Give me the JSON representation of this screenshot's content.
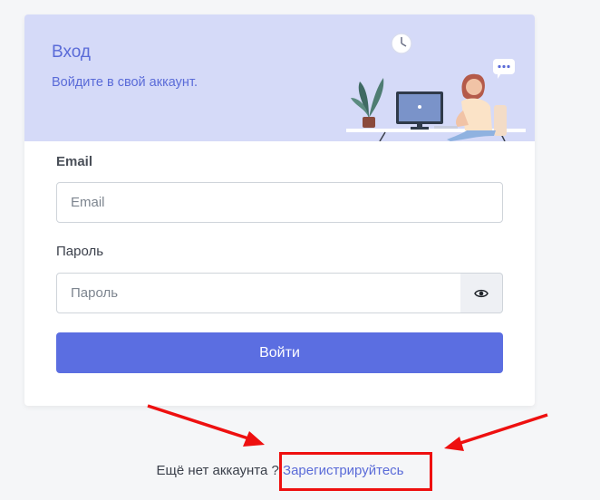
{
  "header": {
    "title": "Вход",
    "subtitle": "Войдите в свой аккаунт."
  },
  "form": {
    "email_label": "Email",
    "email_placeholder": "Email",
    "password_label": "Пароль",
    "password_placeholder": "Пароль",
    "submit_label": "Войти"
  },
  "footer": {
    "question": "Ещё нет аккаунта ?",
    "register_link": "Зарегистрируйтесь"
  },
  "annotation": {
    "color": "#ee1010"
  },
  "colors": {
    "accent": "#5b6ee1",
    "header_bg": "#d5daf8"
  }
}
